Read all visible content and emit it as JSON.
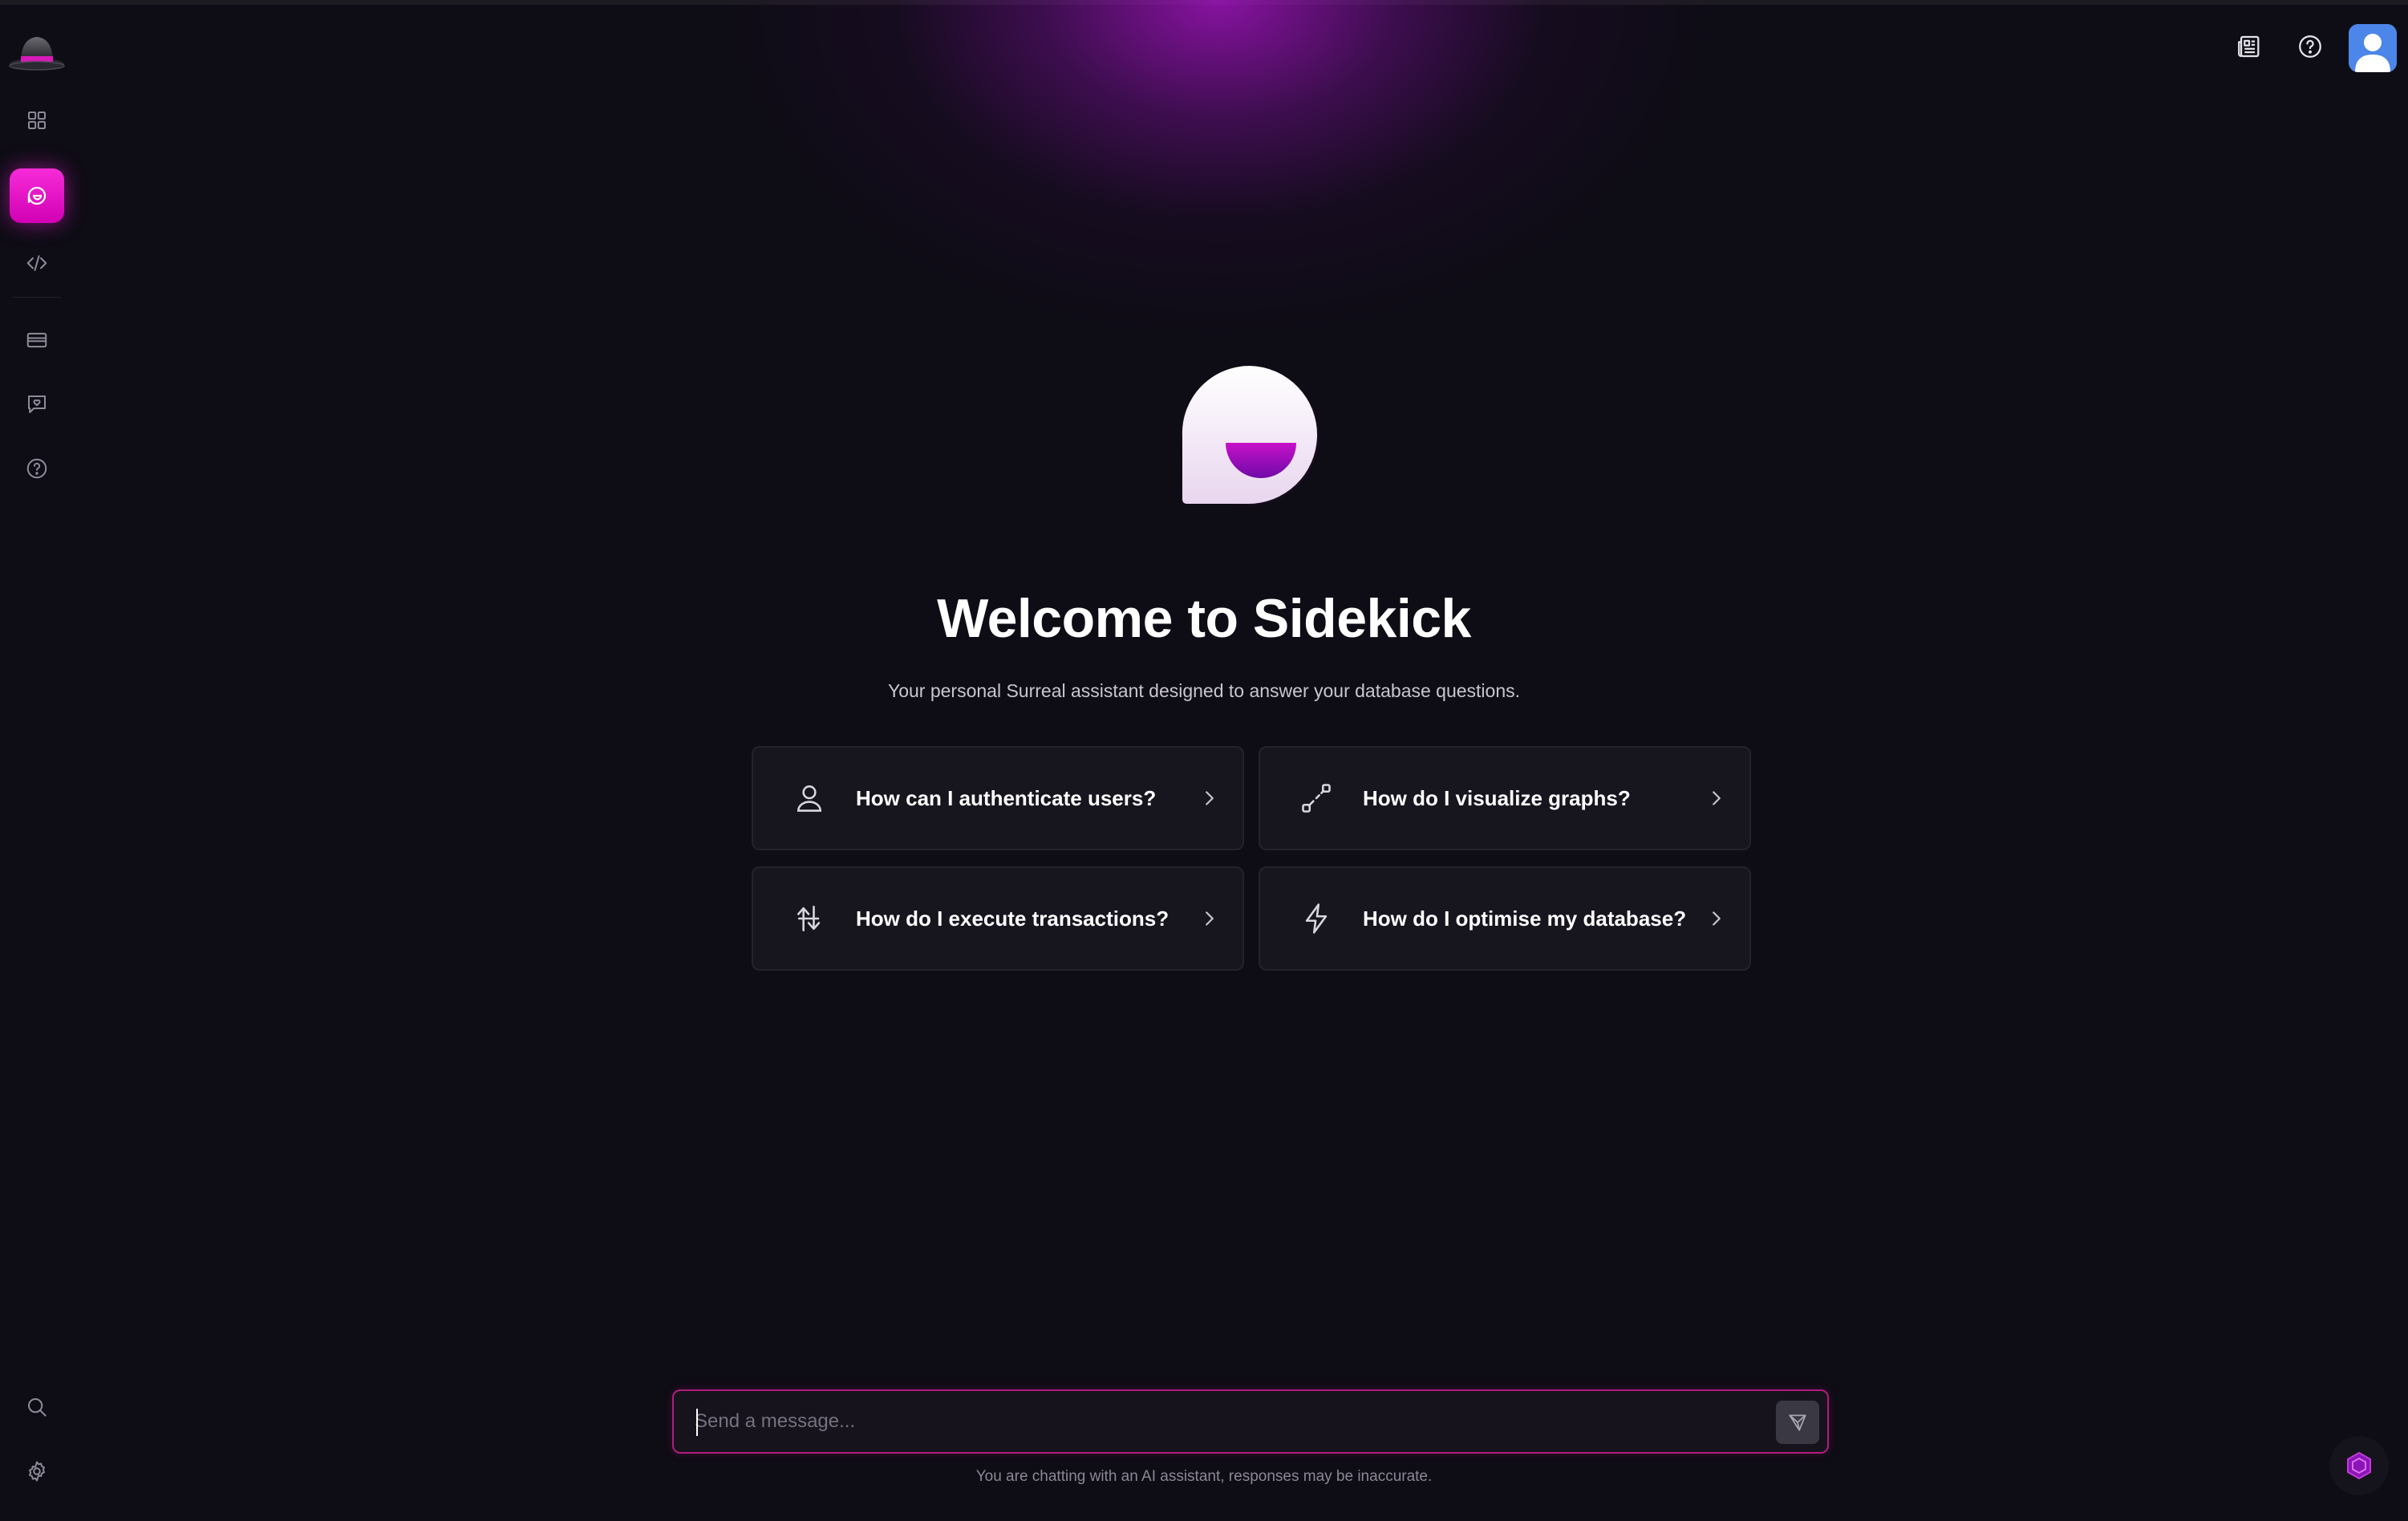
{
  "sidebar": {
    "items": [
      {
        "name": "overview",
        "icon": "grid-icon"
      },
      {
        "name": "sidekick",
        "icon": "sidekick-icon",
        "active": true
      },
      {
        "name": "query",
        "icon": "code-icon"
      },
      {
        "name": "billing",
        "icon": "credit-card-icon"
      },
      {
        "name": "feedback",
        "icon": "heart-chat-icon"
      },
      {
        "name": "help",
        "icon": "help-circle-icon"
      }
    ],
    "bottom": [
      {
        "name": "search",
        "icon": "search-icon"
      },
      {
        "name": "settings",
        "icon": "gear-icon"
      }
    ]
  },
  "header": {
    "icons": [
      "newspaper-icon",
      "help-circle-icon",
      "avatar"
    ]
  },
  "main": {
    "title": "Welcome to Sidekick",
    "subtitle": "Your personal Surreal assistant designed to answer your database questions.",
    "suggestions": [
      {
        "label": "How can I authenticate users?",
        "icon": "user-icon"
      },
      {
        "label": "How do I visualize graphs?",
        "icon": "graph-icon"
      },
      {
        "label": "How do I execute transactions?",
        "icon": "transaction-icon"
      },
      {
        "label": "How do I optimise my database?",
        "icon": "lightning-icon"
      }
    ]
  },
  "composer": {
    "placeholder": "Send a message...",
    "value": "",
    "disclaimer": "You are chatting with an AI assistant, responses may be inaccurate."
  },
  "colors": {
    "accent": "#e31ec6",
    "background": "#0e0c15",
    "card": "#17151e",
    "input_border": "#b01d7c"
  }
}
